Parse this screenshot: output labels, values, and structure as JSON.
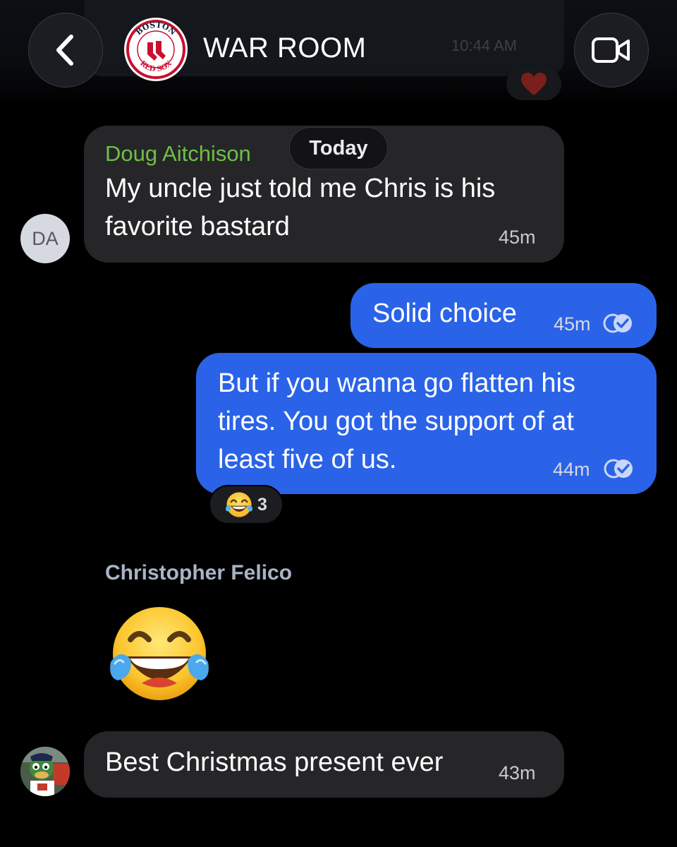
{
  "header": {
    "title": "WAR ROOM",
    "back_icon": "chevron-left-icon",
    "video_icon": "video-camera-icon",
    "group_avatar": "boston-red-sox-logo",
    "group_avatar_text_top": "BOSTON",
    "group_avatar_text_bottom": "RED SOX",
    "background_ghost_time": "10:44 AM"
  },
  "date_separator": "Today",
  "messages": [
    {
      "direction": "incoming",
      "sender": "Doug Aitchison",
      "sender_color": "#6fbf46",
      "avatar_initials": "DA",
      "lines": [
        "My uncle just told me Chris is his",
        "favorite bastard"
      ],
      "time": "45m"
    },
    {
      "direction": "outgoing",
      "lines": [
        "Solid choice"
      ],
      "time": "45m",
      "status_icon": "read-check-icon"
    },
    {
      "direction": "outgoing",
      "lines": [
        "But if you wanna go flatten his",
        "tires.  You got the support of at",
        "least five of us."
      ],
      "time": "44m",
      "status_icon": "read-check-icon",
      "reaction": {
        "icon": "tears-of-joy-emoji",
        "count": "3"
      }
    },
    {
      "direction": "incoming",
      "sender": "Christopher Felico",
      "sender_color": "#a9b3c6",
      "emoji_only": "tears-of-joy-emoji"
    },
    {
      "direction": "incoming",
      "avatar": "mascot-photo",
      "lines": [
        "Best Christmas present ever"
      ],
      "time": "43m"
    }
  ],
  "colors": {
    "background": "#000000",
    "incoming_bubble": "#262629",
    "outgoing_bubble": "#2a63e8"
  }
}
